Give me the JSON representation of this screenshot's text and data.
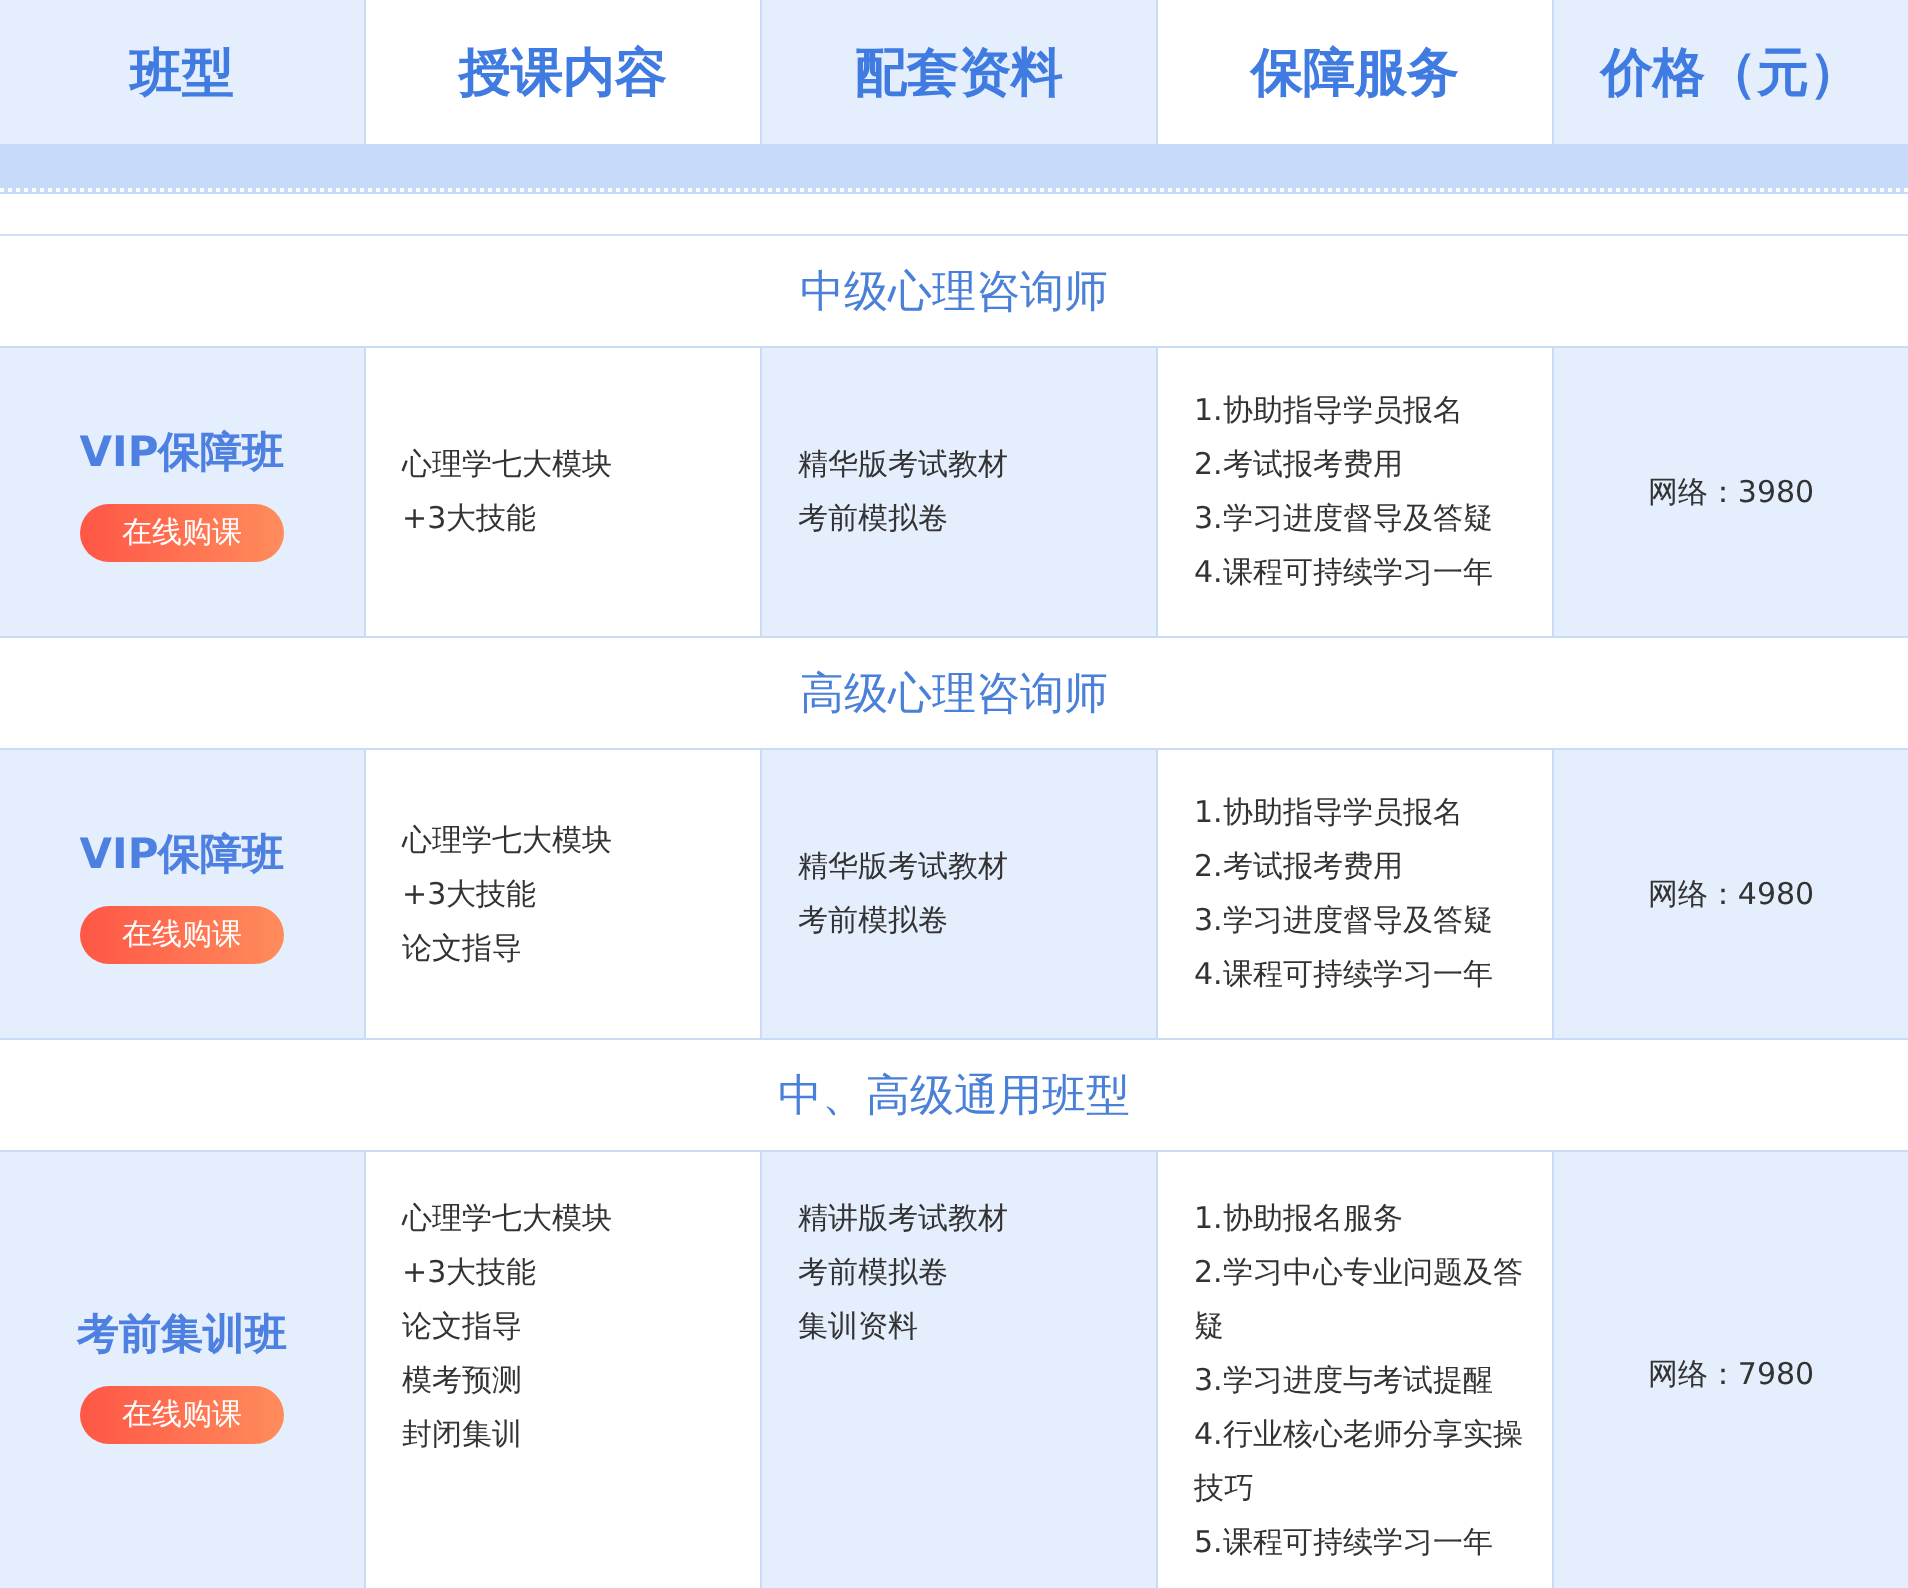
{
  "columns": [
    "班型",
    "授课内容",
    "配套资料",
    "保障服务",
    "价格（元）"
  ],
  "sections": [
    {
      "title": "中级心理咨询师",
      "class_name": "VIP保障班",
      "button": "在线购课",
      "content": [
        "心理学七大模块",
        "+3大技能"
      ],
      "materials": [
        "精华版考试教材",
        "考前模拟卷"
      ],
      "services": [
        "1.协助指导学员报名",
        "2.考试报考费用",
        "3.学习进度督导及答疑",
        "4.课程可持续学习一年"
      ],
      "price": "网络：3980"
    },
    {
      "title": "高级心理咨询师",
      "class_name": "VIP保障班",
      "button": "在线购课",
      "content": [
        "心理学七大模块",
        "+3大技能",
        "论文指导"
      ],
      "materials": [
        "精华版考试教材",
        "考前模拟卷"
      ],
      "services": [
        "1.协助指导学员报名",
        "2.考试报考费用",
        "3.学习进度督导及答疑",
        "4.课程可持续学习一年"
      ],
      "price": "网络：4980"
    },
    {
      "title": "中、高级通用班型",
      "class_name": "考前集训班",
      "button": "在线购课",
      "content": [
        "心理学七大模块",
        "+3大技能",
        "论文指导",
        "模考预测",
        "封闭集训"
      ],
      "materials": [
        "精讲版考试教材",
        "考前模拟卷",
        "集训资料"
      ],
      "services": [
        "1.协助报名服务",
        "2.学习中心专业问题及答疑",
        "3.学习进度与考试提醒",
        "4.行业核心老师分享实操技巧",
        "5.课程可持续学习一年"
      ],
      "price": "网络：7980"
    }
  ]
}
